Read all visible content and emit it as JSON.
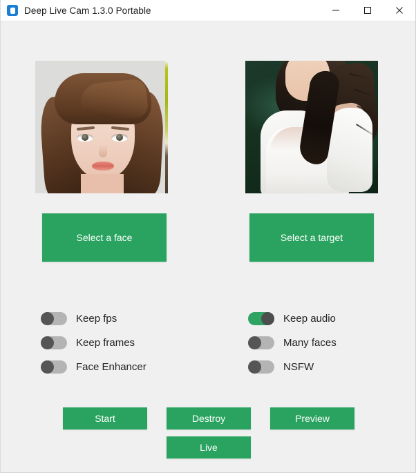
{
  "window": {
    "title": "Deep Live Cam 1.3.0 Portable",
    "app_icon": "app-logo-icon",
    "controls": {
      "minimize": "minimize-icon",
      "maximize": "maximize-icon",
      "close": "close-icon"
    }
  },
  "colors": {
    "accent_green": "#29a35f",
    "toggle_on": "#2fa363",
    "toggle_off_track": "#b4b4b4",
    "toggle_knob": "#555555",
    "window_background": "#f0f0f0",
    "titlebar_background": "#ffffff",
    "title_text": "#1b1b1b"
  },
  "previews": {
    "source": {
      "name": "source-face-preview",
      "description": "Portrait photo of a young woman with long brown hair on a light gray background"
    },
    "target": {
      "name": "target-preview",
      "description": "Photo of a young woman in a white off-shoulder top against a dark green outdoor background"
    }
  },
  "select_buttons": {
    "face_label": "Select a face",
    "target_label": "Select a target"
  },
  "switches": [
    {
      "key": "keep_fps",
      "label": "Keep fps",
      "on": false
    },
    {
      "key": "keep_frames",
      "label": "Keep frames",
      "on": false
    },
    {
      "key": "face_enhancer",
      "label": "Face Enhancer",
      "on": false
    },
    {
      "key": "keep_audio",
      "label": "Keep audio",
      "on": true
    },
    {
      "key": "many_faces",
      "label": "Many faces",
      "on": false
    },
    {
      "key": "nsfw",
      "label": "NSFW",
      "on": false
    }
  ],
  "actions": {
    "start": "Start",
    "destroy": "Destroy",
    "preview": "Preview",
    "live": "Live"
  }
}
